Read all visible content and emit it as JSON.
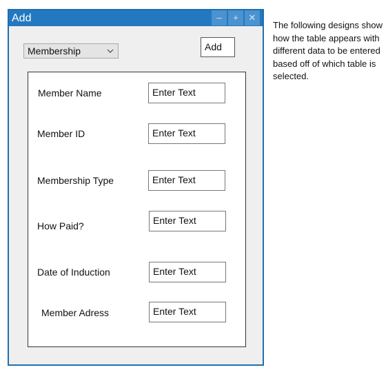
{
  "window": {
    "title": "Add",
    "controls": {
      "minimize": "–",
      "maximize": "+",
      "close": "✕"
    }
  },
  "toolbar": {
    "table_select": {
      "selected": "Membership",
      "icon": "chevron-down-icon"
    },
    "add_button": "Add"
  },
  "form": {
    "fields": [
      {
        "label": "Member Name",
        "placeholder": "Enter Text"
      },
      {
        "label": "Member ID",
        "placeholder": "Enter Text"
      },
      {
        "label": "Membership Type",
        "placeholder": "Enter Text"
      },
      {
        "label": "How Paid?",
        "placeholder": "Enter Text"
      },
      {
        "label": "Date of Induction",
        "placeholder": "Enter Text"
      },
      {
        "label": "Member Adress",
        "placeholder": "Enter Text"
      }
    ]
  },
  "note": {
    "lines": [
      "The following designs show",
      "how the table appears with",
      "different data to be entered",
      "based off of which table is",
      "selected."
    ]
  },
  "colors": {
    "titlebar": "#2378c0",
    "window_border": "#1f6fae",
    "window_background": "#efefef"
  }
}
